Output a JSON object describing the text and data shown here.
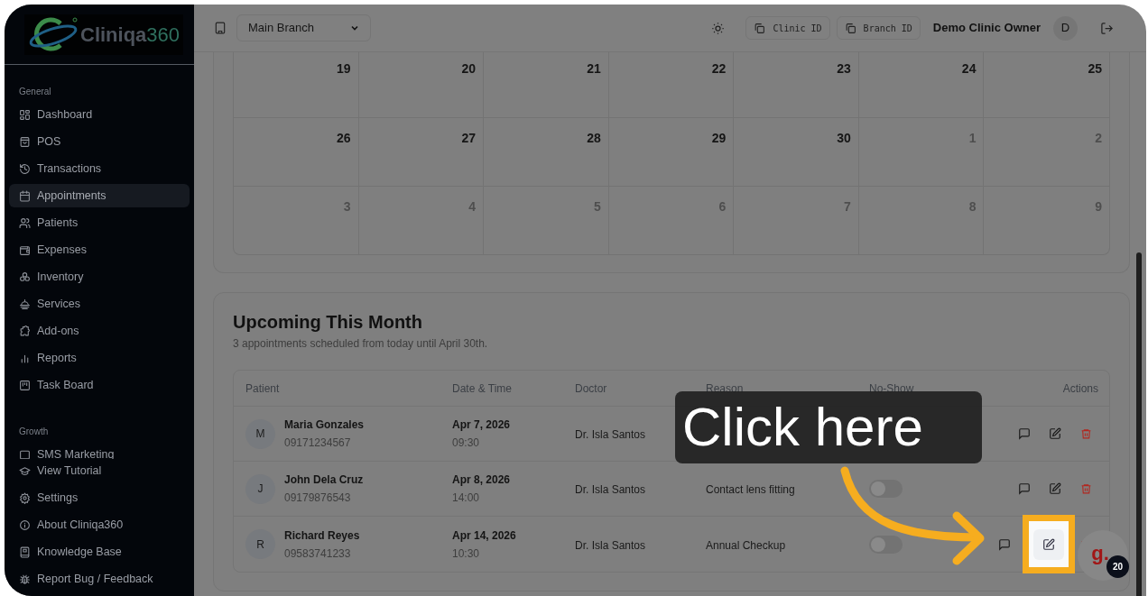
{
  "sidebar": {
    "logo": {
      "name": "Cliniqa",
      "suffix": "360"
    },
    "sections": [
      {
        "title": "General",
        "items": [
          {
            "label": "Dashboard",
            "selected": false
          },
          {
            "label": "POS",
            "selected": false
          },
          {
            "label": "Transactions",
            "selected": false
          },
          {
            "label": "Appointments",
            "selected": true
          },
          {
            "label": "Patients",
            "selected": false
          },
          {
            "label": "Expenses",
            "selected": false
          },
          {
            "label": "Inventory",
            "selected": false
          },
          {
            "label": "Services",
            "selected": false
          },
          {
            "label": "Add-ons",
            "selected": false
          },
          {
            "label": "Reports",
            "selected": false
          },
          {
            "label": "Task Board",
            "selected": false
          }
        ]
      },
      {
        "title": "Growth",
        "items": [
          {
            "label": "SMS Marketing",
            "selected": false
          }
        ]
      }
    ],
    "footer_items": [
      {
        "label": "View Tutorial"
      },
      {
        "label": "Settings"
      },
      {
        "label": "About Cliniqa360"
      },
      {
        "label": "Knowledge Base"
      },
      {
        "label": "Report Bug / Feedback"
      }
    ]
  },
  "header": {
    "branch_select": {
      "value": "Main Branch"
    },
    "copy_buttons": [
      "Clinic ID",
      "Branch ID"
    ],
    "user_name": "Demo Clinic Owner",
    "avatar_initial": "D"
  },
  "calendar": {
    "weeks": [
      [
        {
          "day": "19",
          "muted": false
        },
        {
          "day": "20",
          "muted": false
        },
        {
          "day": "21",
          "muted": false
        },
        {
          "day": "22",
          "muted": false
        },
        {
          "day": "23",
          "muted": false
        },
        {
          "day": "24",
          "muted": false
        },
        {
          "day": "25",
          "muted": false
        }
      ],
      [
        {
          "day": "26",
          "muted": false
        },
        {
          "day": "27",
          "muted": false
        },
        {
          "day": "28",
          "muted": false
        },
        {
          "day": "29",
          "muted": false
        },
        {
          "day": "30",
          "muted": false
        },
        {
          "day": "1",
          "muted": true
        },
        {
          "day": "2",
          "muted": true
        }
      ],
      [
        {
          "day": "3",
          "muted": true
        },
        {
          "day": "4",
          "muted": true
        },
        {
          "day": "5",
          "muted": true
        },
        {
          "day": "6",
          "muted": true
        },
        {
          "day": "7",
          "muted": true
        },
        {
          "day": "8",
          "muted": true
        },
        {
          "day": "9",
          "muted": true
        }
      ]
    ]
  },
  "upcoming": {
    "title": "Upcoming This Month",
    "subtitle": "3 appointments scheduled from today until April 30th.",
    "columns": [
      "Patient",
      "Date & Time",
      "Doctor",
      "Reason",
      "No-Show",
      "Actions"
    ],
    "rows": [
      {
        "initial": "M",
        "name": "Maria Gonzales",
        "phone": "09171234567",
        "date": "Apr 7, 2026",
        "time": "09:30",
        "doctor": "Dr. Isla Santos",
        "highlighted": false
      },
      {
        "initial": "J",
        "name": "John Dela Cruz",
        "phone": "09179876543",
        "date": "Apr 8, 2026",
        "time": "14:00",
        "doctor": "Dr. Isla Santos",
        "reason": "Contact lens fitting",
        "no_show": false,
        "highlighted": false
      },
      {
        "initial": "R",
        "name": "Richard Reyes",
        "phone": "09583741233",
        "date": "Apr 14, 2026",
        "time": "10:30",
        "doctor": "Dr. Isla Santos",
        "reason": "Annual Checkup",
        "no_show": false,
        "highlighted": true
      }
    ]
  },
  "callout": {
    "text": "Click here"
  },
  "help_widget": {
    "letter": "g.",
    "count": "20"
  }
}
